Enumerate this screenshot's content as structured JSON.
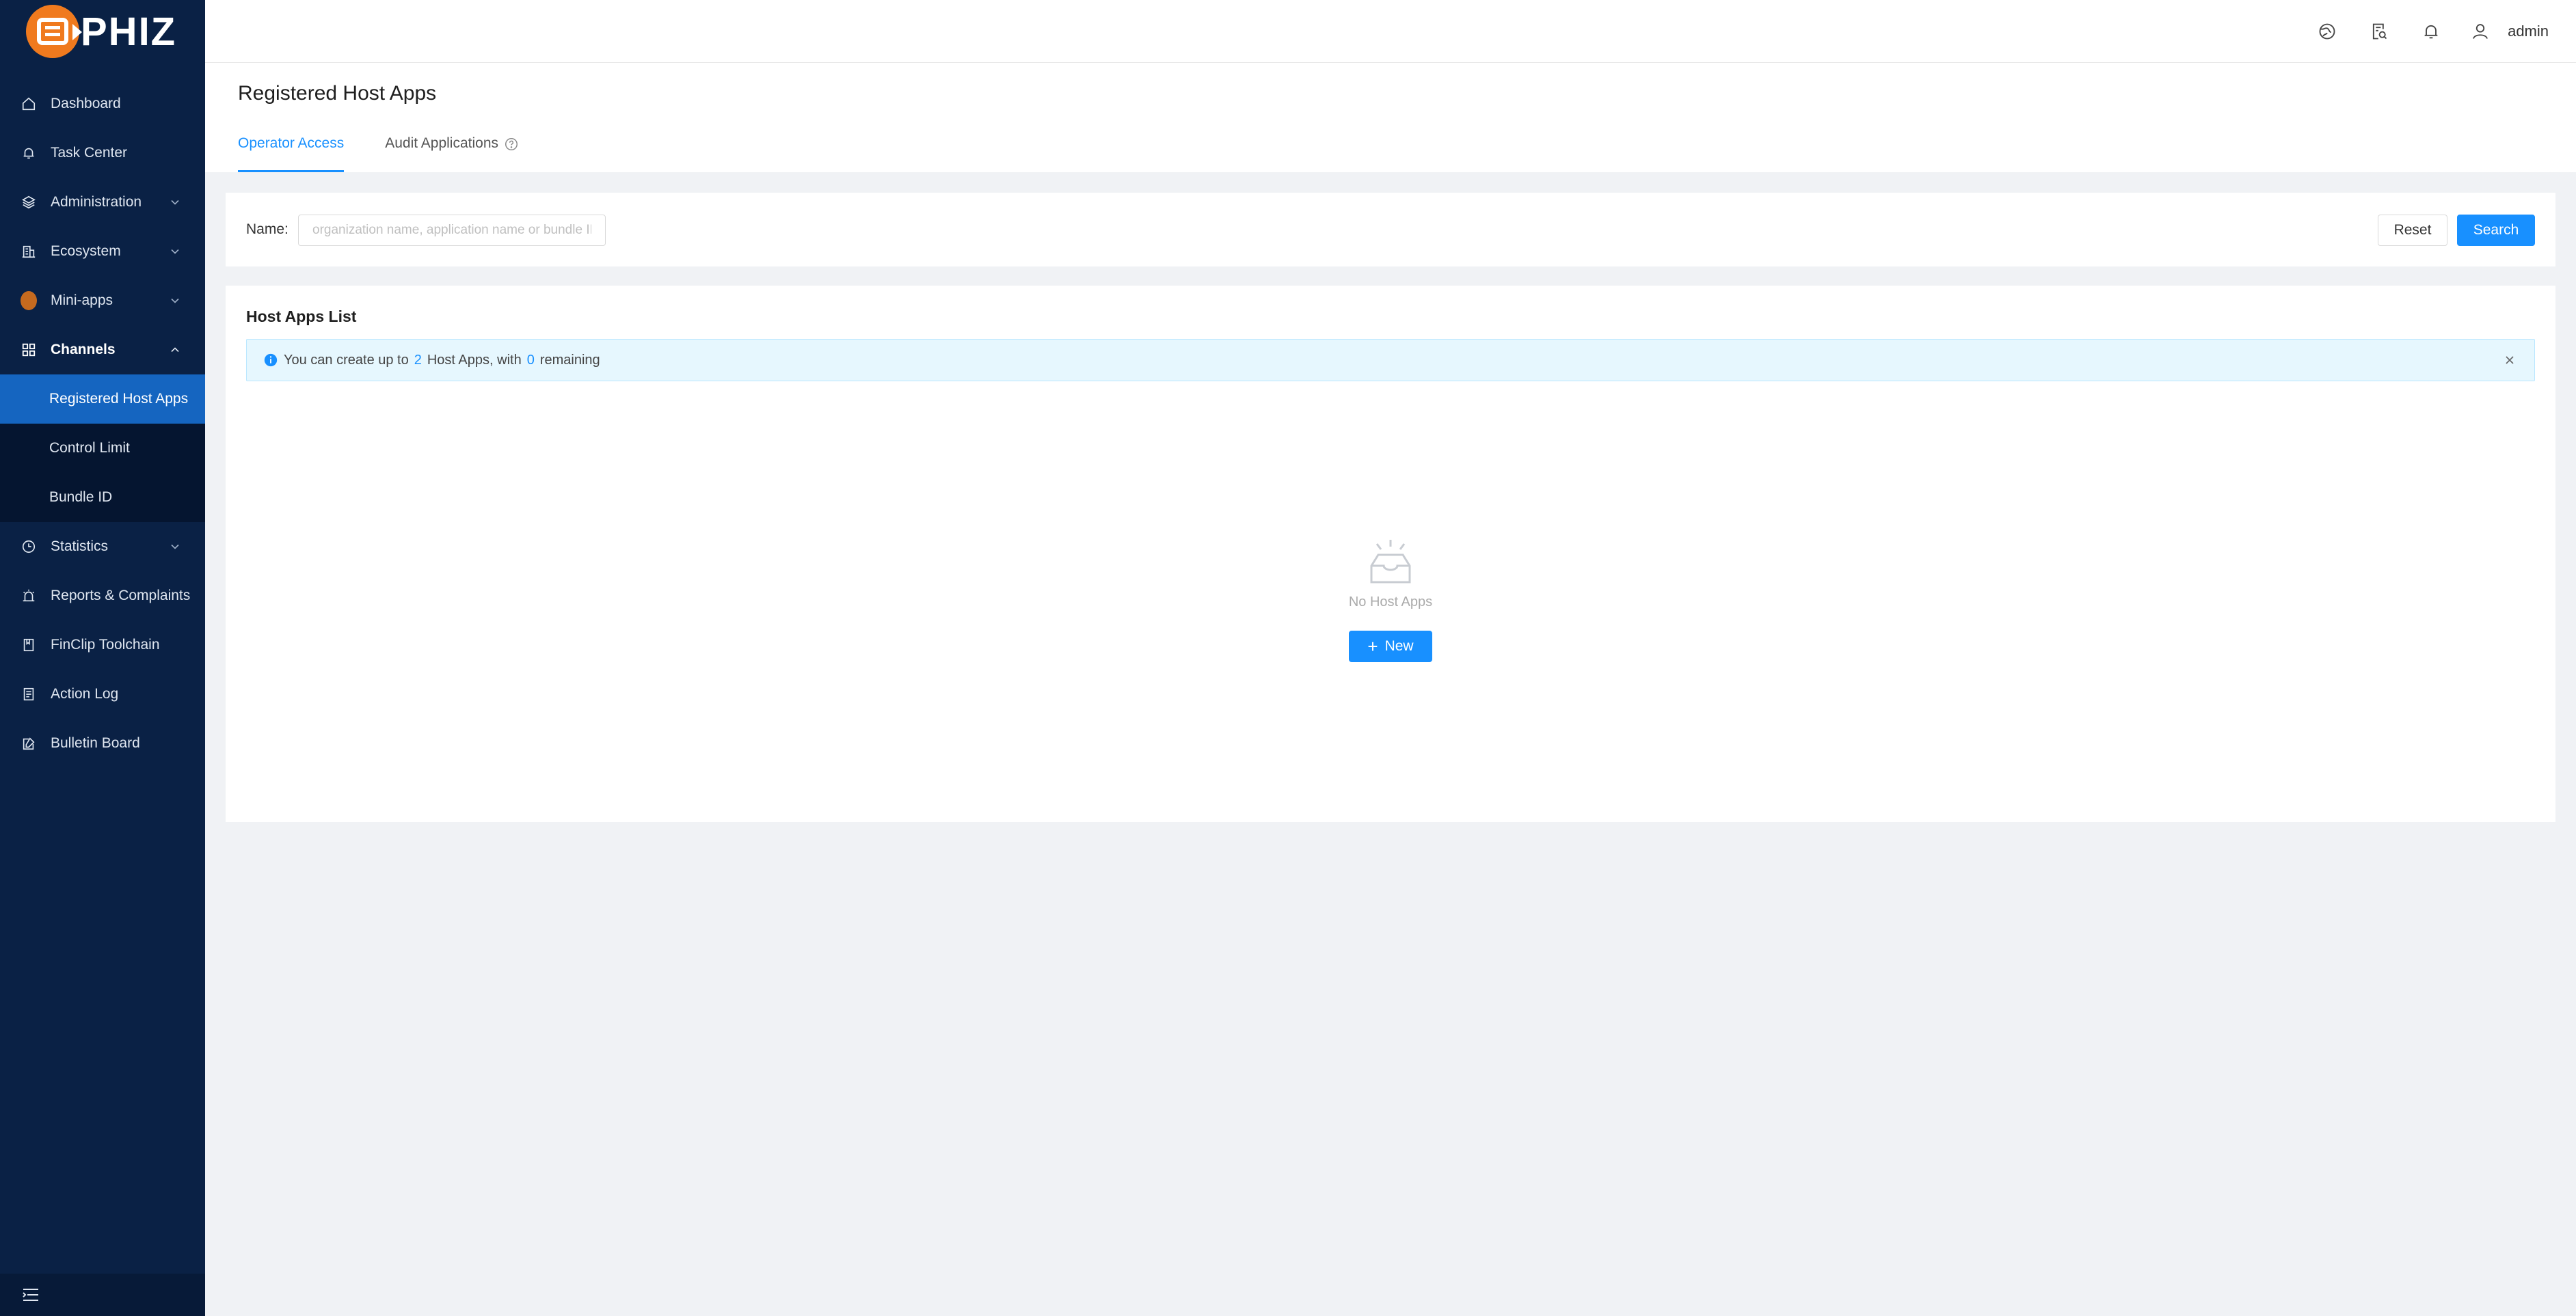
{
  "app": {
    "logo_text": "PHIZ"
  },
  "sidebar": {
    "items": [
      {
        "label": "Dashboard",
        "icon": "home-icon"
      },
      {
        "label": "Task Center",
        "icon": "bell-icon"
      },
      {
        "label": "Administration",
        "icon": "layers-icon",
        "expandable": true
      },
      {
        "label": "Ecosystem",
        "icon": "building-icon",
        "expandable": true
      },
      {
        "label": "Mini-apps",
        "icon": "mini-apps-icon",
        "expandable": true
      },
      {
        "label": "Channels",
        "icon": "grid-icon",
        "expanded": true,
        "children": [
          {
            "label": "Registered Host Apps",
            "active": true
          },
          {
            "label": "Control Limit"
          },
          {
            "label": "Bundle ID"
          }
        ]
      },
      {
        "label": "Statistics",
        "icon": "clock-icon",
        "expandable": true
      },
      {
        "label": "Reports & Complaints",
        "icon": "alarm-icon"
      },
      {
        "label": "FinClip Toolchain",
        "icon": "book-icon"
      },
      {
        "label": "Action Log",
        "icon": "log-icon"
      },
      {
        "label": "Bulletin Board",
        "icon": "edit-icon"
      }
    ]
  },
  "header": {
    "username": "admin"
  },
  "page": {
    "title": "Registered Host Apps",
    "tabs": [
      {
        "label": "Operator Access",
        "active": true
      },
      {
        "label": "Audit Applications",
        "help": true
      }
    ]
  },
  "search": {
    "label": "Name:",
    "placeholder": "organization name, application name or bundle ID",
    "reset_label": "Reset",
    "search_label": "Search"
  },
  "list": {
    "title": "Host Apps List",
    "alert": {
      "prefix": "You can create up to",
      "max_count": "2",
      "middle": "Host Apps, with",
      "remaining_count": "0",
      "suffix": "remaining"
    },
    "empty_text": "No Host Apps",
    "new_label": "New"
  },
  "colors": {
    "sidebar_bg": "#0a2145",
    "active_item_bg": "#1565c0",
    "primary": "#1890ff",
    "alert_bg": "#e6f7fe",
    "logo_orange": "#f07a1e"
  }
}
